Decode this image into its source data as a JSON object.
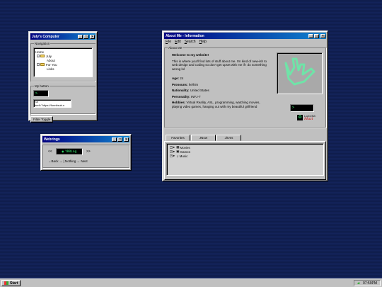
{
  "computer": {
    "title": "July's Computer",
    "nav_label": "Navigation",
    "tree": [
      "Home",
      "July",
      "About",
      "For You",
      "Links"
    ],
    "mybutton_label": "My button",
    "lcd_text": ">",
    "code_line1": "<a",
    "code_line2": "href=\"https://funnitsub.n",
    "filter_button": "Filter Toggle"
  },
  "webring": {
    "title": "Webrings",
    "prev": "<<",
    "next": ">>",
    "badge": "YRRing",
    "nav": "←Back → | Nothing ← Next"
  },
  "about": {
    "title": "About Me - Information",
    "menu": [
      "File",
      "Edit",
      "Search",
      "Help"
    ],
    "group_label": "About Me",
    "welcome": "Welcome to my website!",
    "intro": "This is where you'll find lots of stuff about me. I'm kind of new-ish to web design and coding so don't get upset with me if I do something wrong lol",
    "fields": [
      {
        "label": "Age:",
        "value": "24"
      },
      {
        "label": "Pronouns:",
        "value": "he/him"
      },
      {
        "label": "Nationality:",
        "value": "United States"
      },
      {
        "label": "Personality:",
        "value": "INFJ-T"
      }
    ],
    "hobbies_label": "Hobbies:",
    "hobbies_value": "Virtual Reality, ASL, programming, watching movies, playing video games, hanging out with my beautiful girlfriend",
    "lcd_text": ">",
    "sig_small": "Loved fish",
    "sig_big": "Mazi",
    "tabs": [
      "Favorites",
      "JNow",
      "J/Ives"
    ],
    "tree": [
      "Movies",
      "Games",
      "Music"
    ]
  },
  "taskbar": {
    "start": "Start",
    "time": "07:59PM"
  },
  "colors": {
    "titlebar_start": "#000080",
    "titlebar_end": "#1084d0",
    "lcd_green": "#3bff7a",
    "desktop": "#13235a"
  }
}
